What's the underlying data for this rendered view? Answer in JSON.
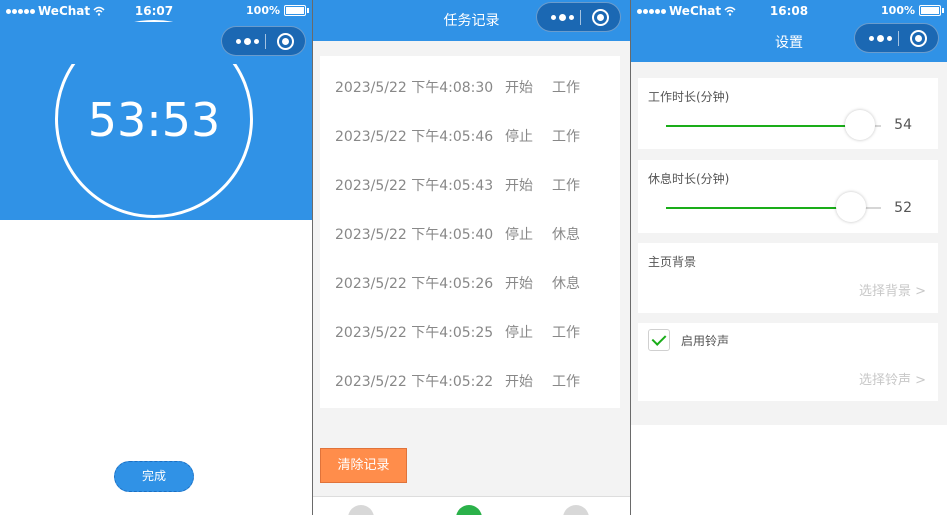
{
  "timer_screen": {
    "status": {
      "carrier": "WeChat",
      "time": "16:07",
      "battery": "100%"
    },
    "clock": "53:53",
    "done_button": "完成"
  },
  "records_screen": {
    "title": "任务记录",
    "records": [
      {
        "time": "2023/5/22 下午4:08:30",
        "action": "开始",
        "type": "工作"
      },
      {
        "time": "2023/5/22 下午4:05:46",
        "action": "停止",
        "type": "工作"
      },
      {
        "time": "2023/5/22 下午4:05:43",
        "action": "开始",
        "type": "工作"
      },
      {
        "time": "2023/5/22 下午4:05:40",
        "action": "停止",
        "type": "休息"
      },
      {
        "time": "2023/5/22 下午4:05:26",
        "action": "开始",
        "type": "休息"
      },
      {
        "time": "2023/5/22 下午4:05:25",
        "action": "停止",
        "type": "工作"
      },
      {
        "time": "2023/5/22 下午4:05:22",
        "action": "开始",
        "type": "工作"
      }
    ],
    "clear_button": "清除记录"
  },
  "settings_screen": {
    "status": {
      "carrier": "WeChat",
      "time": "16:08",
      "battery": "100%"
    },
    "title": "设置",
    "work_duration": {
      "label": "工作时长(分钟)",
      "value": "54",
      "fraction": 0.9
    },
    "rest_duration": {
      "label": "休息时长(分钟)",
      "value": "52",
      "fraction": 0.86
    },
    "background": {
      "label": "主页背景",
      "action": "选择背景 >"
    },
    "ringtone": {
      "label": "启用铃声",
      "checked": true,
      "action": "选择铃声 >"
    }
  },
  "colors": {
    "primary": "#3092e6",
    "capsule": "#1b68b3",
    "orange": "#ff8d4b",
    "green": "#1aad19"
  },
  "icons": {
    "signal": "signal-dots-icon",
    "wifi": "wifi-icon",
    "battery": "battery-icon",
    "more": "more-dots-icon",
    "close": "capsule-close-icon",
    "checkbox": "checkmark-icon"
  }
}
